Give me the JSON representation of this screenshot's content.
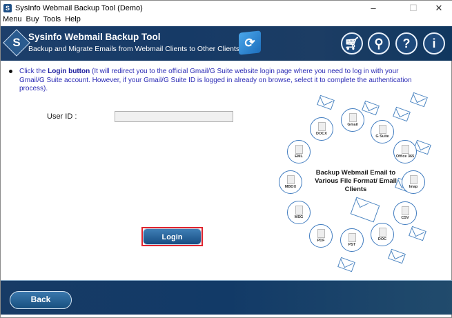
{
  "window": {
    "title": "SysInfo Webmail Backup Tool (Demo)",
    "minimize": "–",
    "maximize": "☐",
    "close": "✕"
  },
  "menu": [
    "Menu",
    "Buy",
    "Tools",
    "Help"
  ],
  "banner": {
    "logo_letter": "S",
    "title": "Sysinfo Webmail Backup Tool",
    "subtitle": "Backup and Migrate Emails from Webmail Clients to Other Clients",
    "icons": [
      "cart-icon",
      "key-icon",
      "help-icon",
      "info-icon"
    ]
  },
  "instruction": {
    "prefix": "Click the ",
    "bold": "Login button",
    "rest": " (It will redirect you to the official Gmail/G Suite website login page where you need to log in with your Gmail/G Suite account. However, if your Gmail/G Suite ID is logged in already on browse, select it to complete the authentication process)."
  },
  "form": {
    "user_id_label": "User ID  :",
    "user_id_value": ""
  },
  "login_label": "Login",
  "back_label": "Back",
  "illustration": {
    "center_text": "Backup Webmail Email to Various File Format/ Email Clients",
    "items": [
      "Gmail",
      "G Suite",
      "Office 365",
      "Imap",
      "CSV",
      "DOC",
      "PST",
      "PDF",
      "MSG",
      "MBOX",
      "EML",
      "DOCX"
    ]
  },
  "colors": {
    "banner": "#1d3f6b",
    "instruction_text": "#2b2bb5",
    "highlight": "#e0242e"
  }
}
